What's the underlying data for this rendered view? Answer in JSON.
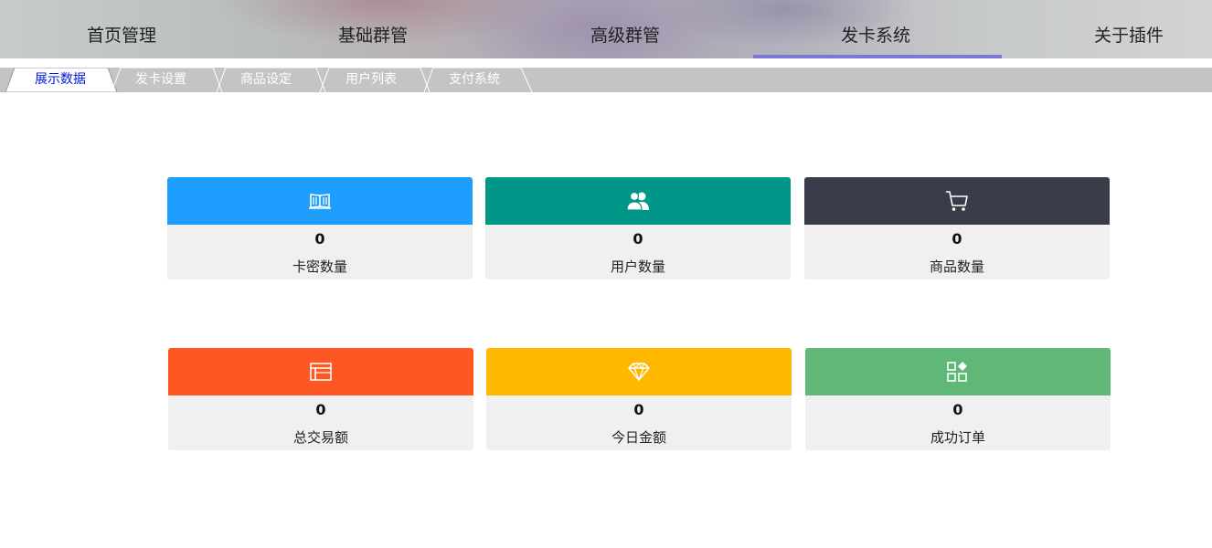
{
  "nav": {
    "items": [
      {
        "label": "首页管理"
      },
      {
        "label": "基础群管"
      },
      {
        "label": "高级群管"
      },
      {
        "label": "发卡系统"
      },
      {
        "label": "关于插件"
      }
    ],
    "active": "发卡系统",
    "active_color": "#7b78d8"
  },
  "tabs": {
    "items": [
      {
        "label": "展示数据"
      },
      {
        "label": "发卡设置"
      },
      {
        "label": "商品设定"
      },
      {
        "label": "用户列表"
      },
      {
        "label": "支付系统"
      }
    ],
    "active": "展示数据",
    "active_color": "#0018d8"
  },
  "stats": [
    {
      "label": "卡密数量",
      "value": "0",
      "color": "#1e9fff",
      "icon": "book-icon"
    },
    {
      "label": "用户数量",
      "value": "0",
      "color": "#009688",
      "icon": "users-icon"
    },
    {
      "label": "商品数量",
      "value": "0",
      "color": "#393d49",
      "icon": "cart-icon"
    },
    {
      "label": "总交易额",
      "value": "0",
      "color": "#ff5722",
      "icon": "browser-window-icon"
    },
    {
      "label": "今日金额",
      "value": "0",
      "color": "#ffb800",
      "icon": "diamond-icon"
    },
    {
      "label": "成功订单",
      "value": "0",
      "color": "#5fb878",
      "icon": "app-grid-icon"
    }
  ]
}
